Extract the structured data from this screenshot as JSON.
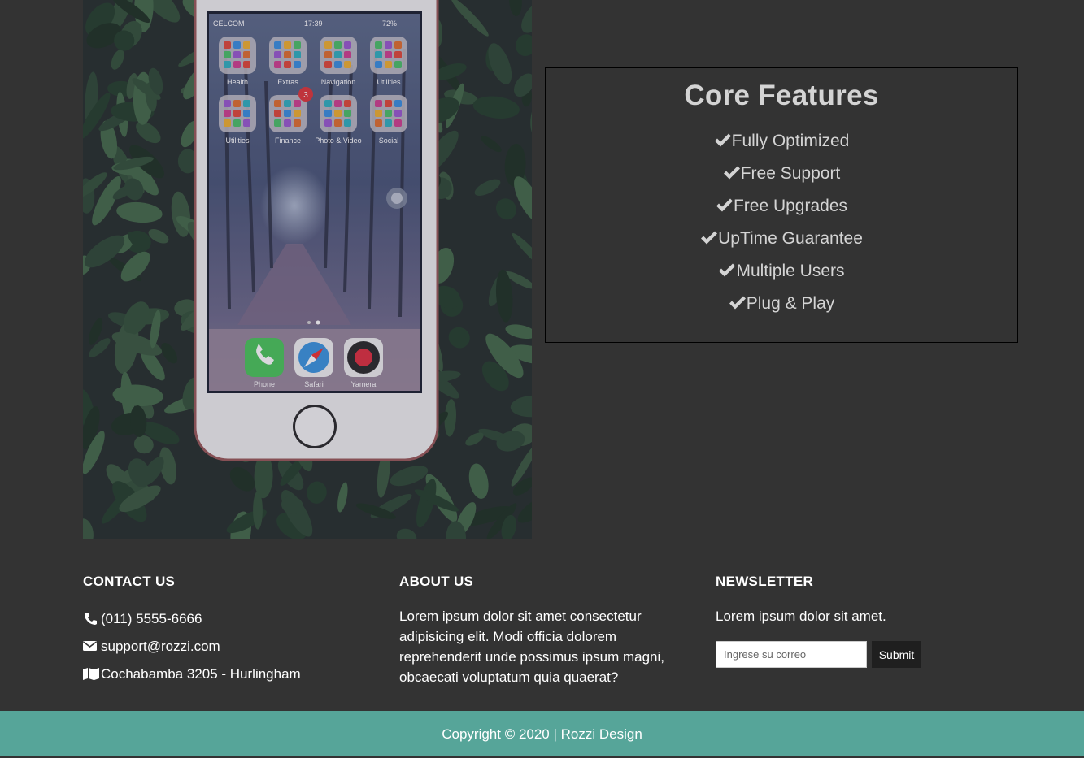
{
  "features": {
    "title": "Core Features",
    "items": [
      {
        "icon": "check-icon",
        "label": "Fully Optimized"
      },
      {
        "icon": "check-icon",
        "label": "Free Support"
      },
      {
        "icon": "check-icon",
        "label": "Free Upgrades"
      },
      {
        "icon": "check-icon",
        "label": "UpTime Guarantee"
      },
      {
        "icon": "check-icon",
        "label": "Multiple Users"
      },
      {
        "icon": "check-icon",
        "label": "Plug & Play"
      }
    ]
  },
  "phone_screen": {
    "carrier": "CELCOM",
    "time": "17:39",
    "battery": "72%",
    "folders": [
      "Health",
      "Extras",
      "Navigation",
      "Utilities",
      "Utilities",
      "Finance",
      "Photo & Video",
      "Social"
    ],
    "badge_count": "3",
    "dock": [
      "Phone",
      "Safari",
      "Yamera"
    ]
  },
  "contact": {
    "title": "CONTACT US",
    "phone": "(011) 5555-6666",
    "email": "support@rozzi.com",
    "address": "Cochabamba 3205 - Hurlingham"
  },
  "about": {
    "title": "ABOUT US",
    "text": "Lorem ipsum dolor sit amet consectetur adipisicing elit. Modi officia dolorem reprehenderit unde possimus ipsum magni, obcaecati voluptatum quia quaerat?"
  },
  "newsletter": {
    "title": "NEWSLETTER",
    "text": "Lorem ipsum dolor sit amet.",
    "input_placeholder": "Ingrese su correo",
    "input_value": "",
    "submit_label": "Submit"
  },
  "footer": {
    "copyright": "Copyright © 2020 | Rozzi Design"
  },
  "colors": {
    "background": "#333333",
    "bottom_bar": "#56a599",
    "feature_text": "#d4d4d4",
    "submit_button": "#1f1f1f"
  }
}
